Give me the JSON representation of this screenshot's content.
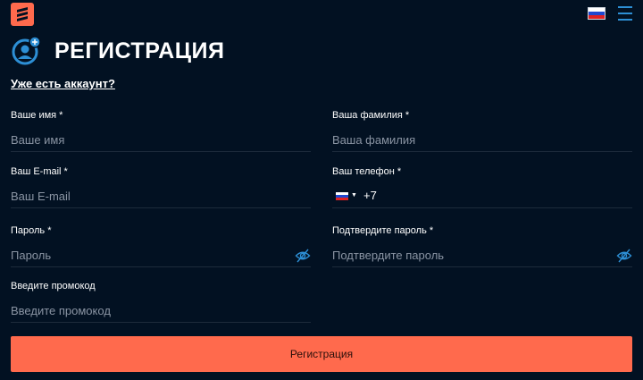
{
  "header": {
    "logo_icon": "brand-logo-icon",
    "language_flag": "russia-flag-icon",
    "menu_icon": "hamburger-menu-icon",
    "flag_colors": [
      "#ffffff",
      "#1f48d0",
      "#e02121"
    ]
  },
  "page": {
    "title": "РЕГИСТРАЦИЯ",
    "title_icon": "user-add-icon",
    "login_link": "Уже есть аккаунт?"
  },
  "form": {
    "first_name": {
      "label": "Ваше имя *",
      "placeholder": "Ваше имя"
    },
    "last_name": {
      "label": "Ваша фамилия *",
      "placeholder": "Ваша фамилия"
    },
    "email": {
      "label": "Ваш E-mail *",
      "placeholder": "Ваш E-mail"
    },
    "phone": {
      "label": "Ваш телефон *",
      "country_code": "+7",
      "country_flag": "russia-flag-icon"
    },
    "password": {
      "label": "Пароль *",
      "placeholder": "Пароль",
      "toggle_icon": "eye-off-icon"
    },
    "confirm_password": {
      "label": "Подтвердите пароль *",
      "placeholder": "Подтвердите пароль",
      "toggle_icon": "eye-off-icon"
    },
    "promo": {
      "label": "Введите промокод",
      "placeholder": "Введите промокод"
    },
    "submit_label": "Регистрация"
  },
  "colors": {
    "background": "#021122",
    "accent": "#ff6a4d",
    "icon_blue": "#2d8fd5",
    "placeholder": "#8a94a3"
  }
}
